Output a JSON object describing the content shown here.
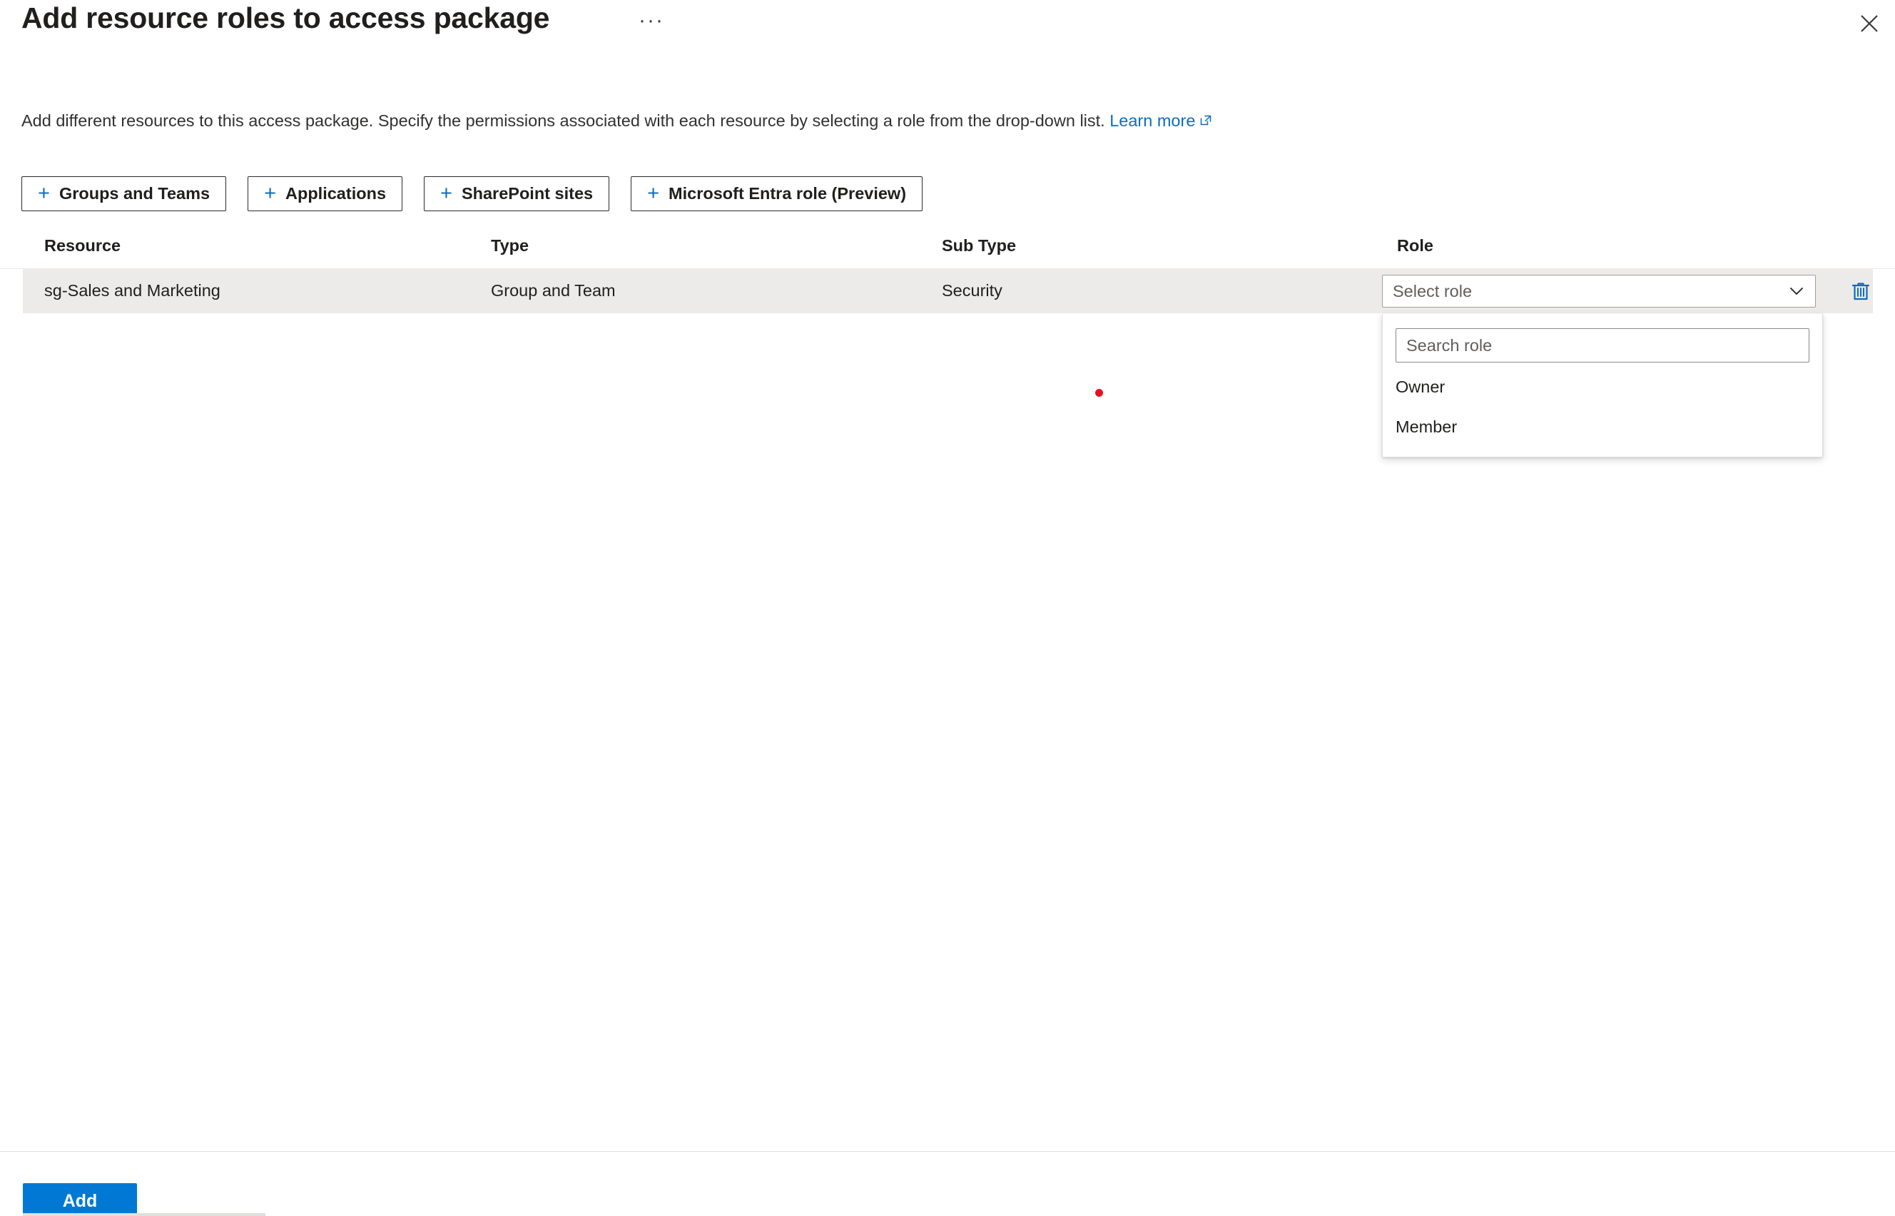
{
  "blade": {
    "title": "Add resource roles to access package",
    "ellipsis_label": "···",
    "close_label": "Close"
  },
  "description": {
    "text": "Add different resources to this access package. Specify the permissions associated with each resource by selecting a role from the drop-down list.",
    "link_label": "Learn more"
  },
  "add_buttons": [
    {
      "label": "Groups and Teams",
      "icon": "plus-icon"
    },
    {
      "label": "Applications",
      "icon": "plus-icon"
    },
    {
      "label": "SharePoint sites",
      "icon": "plus-icon"
    },
    {
      "label": "Microsoft Entra role (Preview)",
      "icon": "plus-icon"
    }
  ],
  "table": {
    "columns": [
      "Resource",
      "Type",
      "Sub Type",
      "Role"
    ],
    "rows": [
      {
        "resource": "sg-Sales and Marketing",
        "type": "Group and Team",
        "sub_type": "Security",
        "role_placeholder": "Select role",
        "delete_label": "Delete"
      }
    ]
  },
  "role_dropdown": {
    "open": true,
    "search_placeholder": "Search role",
    "search_value": "",
    "options": [
      "Owner",
      "Member"
    ]
  },
  "footer": {
    "add_label": "Add"
  },
  "colors": {
    "accent": "#0078d4",
    "link": "#0f6cbd",
    "row_selected": "#edebe9",
    "cursor_dot": "#e81123",
    "text_primary": "#201f1e",
    "text_secondary": "#605e5c",
    "border": "#a19f9d"
  }
}
